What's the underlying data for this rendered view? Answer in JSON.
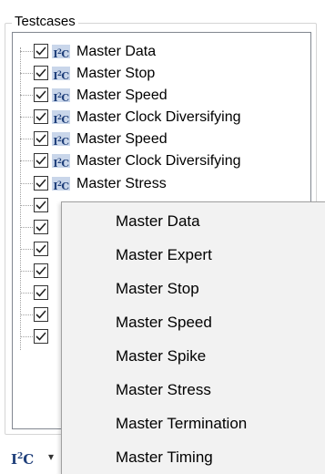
{
  "testcases_group": {
    "title": "Testcases",
    "items": [
      {
        "label": "Master Data",
        "checked": true
      },
      {
        "label": "Master Stop",
        "checked": true
      },
      {
        "label": "Master Speed",
        "checked": true
      },
      {
        "label": "Master Clock Diversifying",
        "checked": true
      },
      {
        "label": "Master Speed",
        "checked": true
      },
      {
        "label": "Master Clock Diversifying",
        "checked": true
      },
      {
        "label": "Master Stress",
        "checked": true
      }
    ],
    "icon": "i2c-icon",
    "icon_text": "I",
    "icon_sup": "2",
    "icon_tail": "C"
  },
  "toolbar": {
    "add_icon_text": "I",
    "add_icon_sup": "2",
    "add_icon_tail": "C",
    "dropdown_icon": "chevron-down-icon"
  },
  "context_menu": {
    "items": [
      {
        "label": "Master Data"
      },
      {
        "label": "Master Expert"
      },
      {
        "label": "Master Stop"
      },
      {
        "label": "Master Speed"
      },
      {
        "label": "Master Spike"
      },
      {
        "label": "Master Stress"
      },
      {
        "label": "Master Termination"
      },
      {
        "label": "Master Timing"
      }
    ]
  },
  "colors": {
    "menu_background": "#f2f2f2",
    "icon_background": "#c9d6ea",
    "icon_text": "#1f3f7a"
  }
}
